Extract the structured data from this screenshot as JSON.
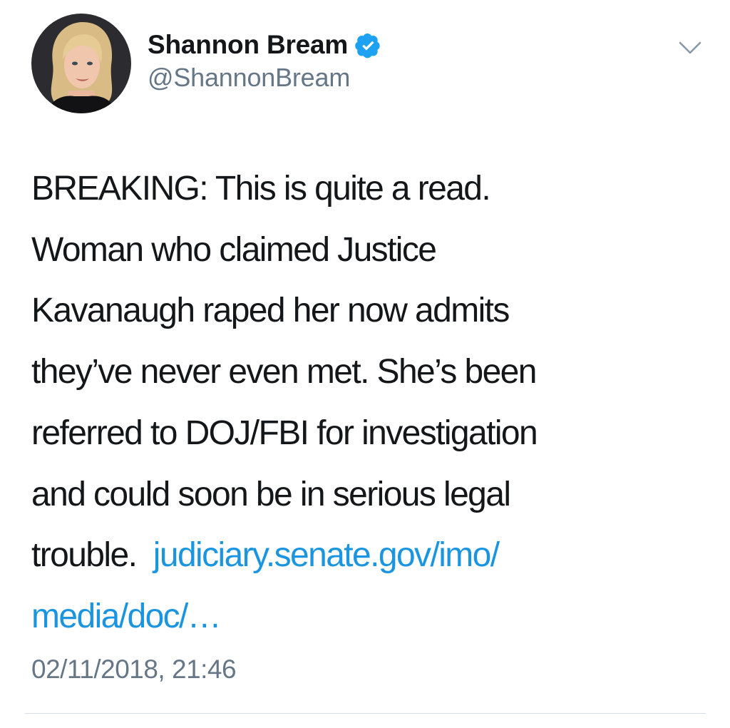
{
  "tweet": {
    "author": {
      "display_name": "Shannon Bream",
      "handle": "@ShannonBream",
      "verified": true,
      "avatar_icon": "user-avatar",
      "verified_icon": "verified-badge-icon"
    },
    "menu_icon": "chevron-down-icon",
    "text_lines": [
      "BREAKING:  This is quite a read.",
      "Woman who claimed Justice",
      "Kavanaugh raped her now admits",
      "they’ve never even met. She’s been",
      "referred to DOJ/FBI for investigation",
      "and could soon be in serious legal",
      "trouble.  "
    ],
    "link_lines": [
      "judiciary.senate.gov/imo/",
      "media/doc/…"
    ],
    "timestamp": "02/11/2018, 21:46"
  },
  "colors": {
    "text": "#14171a",
    "secondary": "#657786",
    "link": "#1b95e0",
    "verified": "#1da1f2",
    "divider": "#d8dee3"
  }
}
